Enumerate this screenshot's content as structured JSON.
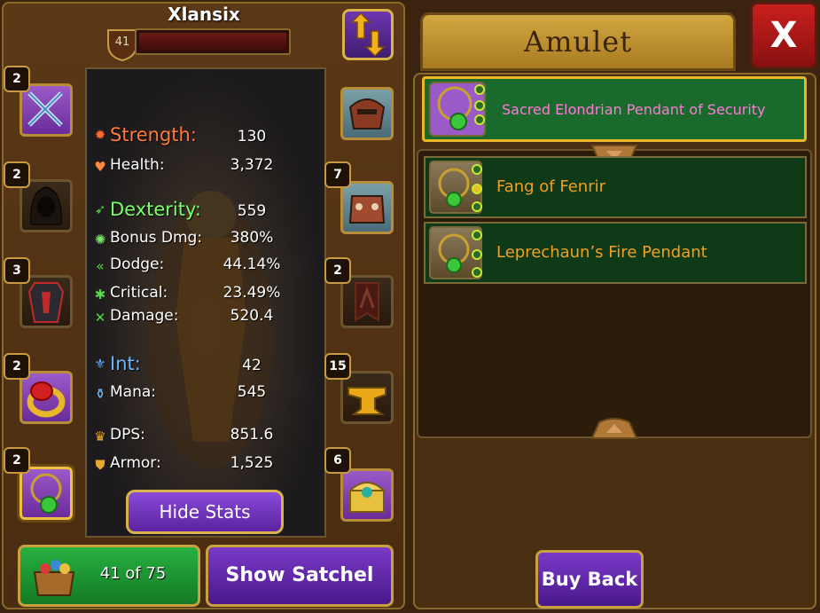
{
  "character": {
    "name": "Xlansix",
    "level": "41"
  },
  "stats": [
    {
      "label": "Strength:",
      "value": "130",
      "icon": "strength-icon",
      "color": "#ff7a3a",
      "big": true
    },
    {
      "label": "Health:",
      "value": "3,372",
      "icon": "health-icon",
      "color": "#ffffff",
      "big": false
    },
    {
      "label": "Dexterity:",
      "value": "559",
      "icon": "dexterity-icon",
      "color": "#7aff6a",
      "big": true
    },
    {
      "label": "Bonus Dmg:",
      "value": "380%",
      "icon": "bonus-damage-icon",
      "color": "#ffffff",
      "big": false
    },
    {
      "label": "Dodge:",
      "value": "44.14%",
      "icon": "dodge-icon",
      "color": "#ffffff",
      "big": false
    },
    {
      "label": "Critical:",
      "value": "23.49%",
      "icon": "critical-icon",
      "color": "#ffffff",
      "big": false
    },
    {
      "label": "Damage:",
      "value": "520.4",
      "icon": "damage-icon",
      "color": "#ffffff",
      "big": false
    },
    {
      "label": "Int:",
      "value": "42",
      "icon": "int-icon",
      "color": "#6ab8ff",
      "big": true
    },
    {
      "label": "Mana:",
      "value": "545",
      "icon": "mana-icon",
      "color": "#ffffff",
      "big": false
    },
    {
      "label": "DPS:",
      "value": "851.6",
      "icon": "dps-icon",
      "color": "#ffffff",
      "big": false
    },
    {
      "label": "Armor:",
      "value": "1,525",
      "icon": "armor-icon",
      "color": "#ffffff",
      "big": false
    }
  ],
  "buttons": {
    "hide_stats": "Hide Stats",
    "satchel_count": "41 of 75",
    "show_satchel": "Show Satchel",
    "buy_back": "Buy Back",
    "close": "X"
  },
  "slots_left": [
    {
      "count": "2",
      "icon": "crossed-swords-icon"
    },
    {
      "count": "2",
      "icon": "hood-icon"
    },
    {
      "count": "3",
      "icon": "armor-chest-icon"
    },
    {
      "count": "2",
      "icon": "ring-icon"
    },
    {
      "count": "2",
      "icon": "amulet-icon"
    }
  ],
  "slots_right": [
    {
      "count": "",
      "icon": "helmet-icon"
    },
    {
      "count": "7",
      "icon": "shoulders-icon"
    },
    {
      "count": "2",
      "icon": "banner-icon"
    },
    {
      "count": "15",
      "icon": "anvil-icon"
    },
    {
      "count": "6",
      "icon": "treasure-chest-icon"
    }
  ],
  "panel": {
    "title": "Amulet",
    "selected_item": "Sacred Elondrian Pendant of Security",
    "items": [
      {
        "label": "Fang of Fenrir"
      },
      {
        "label": "Leprechaun’s Fire Pendant"
      }
    ]
  },
  "colors": {
    "selected_label": "#ff7ad6",
    "item_label": "#f0a020"
  }
}
